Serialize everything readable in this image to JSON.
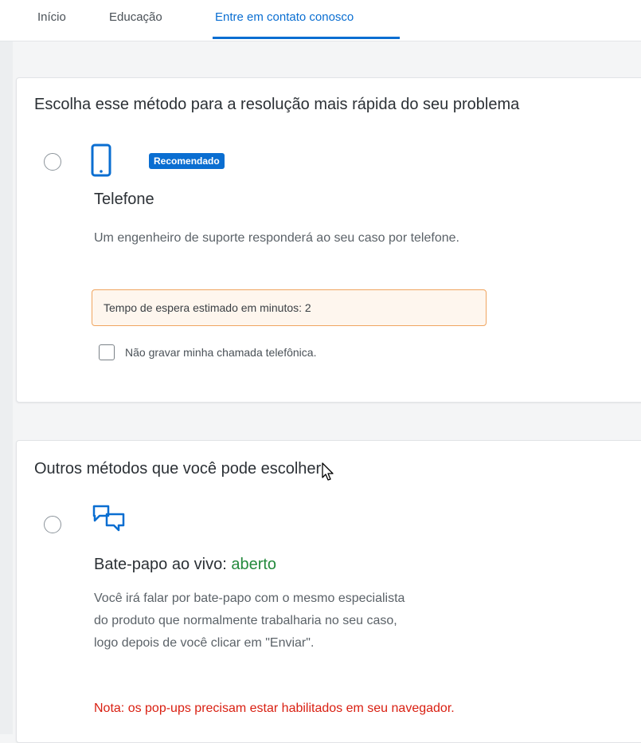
{
  "tabs": [
    {
      "label": "Início"
    },
    {
      "label": "Educação"
    },
    {
      "label": "Entre em contato conosco"
    }
  ],
  "colors": {
    "accent": "#0a6ed1",
    "warning_border": "#f0a560",
    "open": "#248a3d",
    "note": "#d91f11"
  },
  "recommended": {
    "heading": "Escolha esse método para a resolução mais rápida do seu problema",
    "icon": "phone-icon",
    "badge": "Recomendado",
    "title": "Telefone",
    "description": "Um engenheiro de suporte responderá ao seu caso por telefone.",
    "wait_time": "Tempo de espera estimado em minutos: 2",
    "checkbox_label": "Não gravar minha chamada telefônica."
  },
  "others": {
    "heading": "Outros métodos que você pode escolher:",
    "icon": "chat-icon",
    "title": "Bate-papo ao vivo:",
    "status": "aberto",
    "description": "Você irá falar por bate-papo com o mesmo especialista do produto que normalmente trabalharia no seu caso, logo depois de você clicar em \"Enviar\".",
    "note": "Nota: os pop-ups precisam estar habilitados em seu navegador."
  }
}
